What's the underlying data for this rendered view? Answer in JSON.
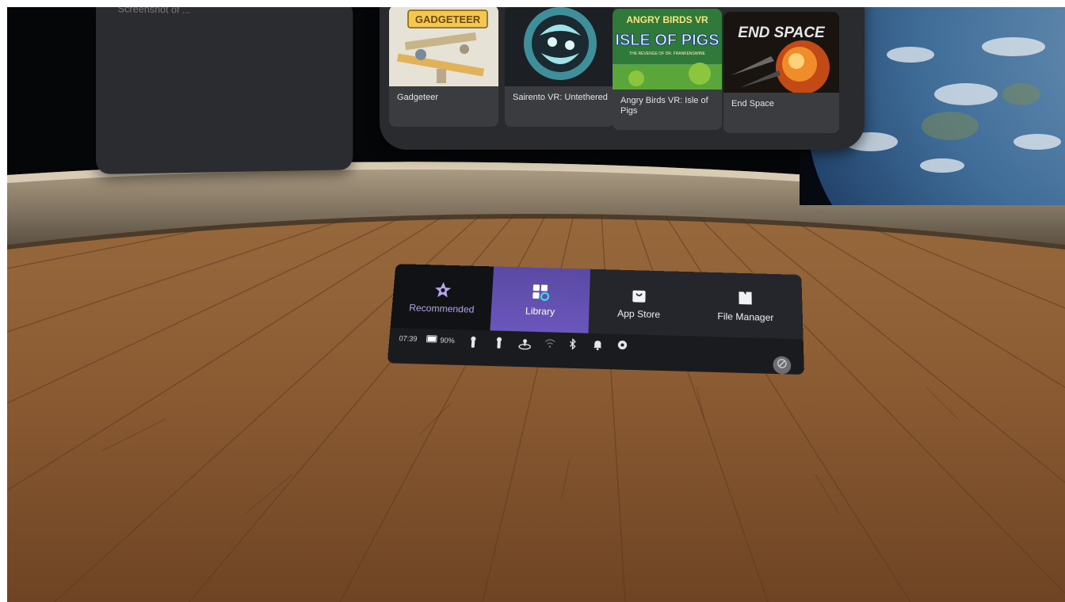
{
  "scene": {
    "left_panel_caption": "Screenshot of ...",
    "colors": {
      "shelf": "#2a2b2e",
      "nav_active": "#6b56bd",
      "recommended_text": "#b9a5f0",
      "wood": "#8a5a32"
    }
  },
  "library": {
    "apps": [
      {
        "title": "Gadgeteer",
        "art_text": "GADGETEER"
      },
      {
        "title": "Sairento VR: Untethered",
        "art_text": ""
      },
      {
        "title": "Angry Birds VR: Isle of Pigs",
        "art_text_line1": "ANGRY BIRDS VR",
        "art_text_line2": "ISLE OF PIGS",
        "art_text_line3": "THE REVENGE OF DR. FRANKENSWINE"
      },
      {
        "title": "End Space",
        "art_text": "END SPACE"
      }
    ]
  },
  "nav": {
    "tabs": [
      {
        "label": "Recommended",
        "icon": "star-icon",
        "active": false
      },
      {
        "label": "Library",
        "icon": "grid-icon",
        "active": true
      },
      {
        "label": "App Store",
        "icon": "shopping-bag-icon",
        "active": false
      },
      {
        "label": "File Manager",
        "icon": "folder-icon",
        "active": false
      }
    ],
    "status": {
      "time": "07:39",
      "battery": "90%",
      "icons": [
        "controller-left-icon",
        "controller-right-icon",
        "boundary-icon",
        "wifi-icon",
        "bluetooth-icon",
        "bell-icon",
        "settings-icon"
      ]
    },
    "power_icon": "power-icon"
  }
}
